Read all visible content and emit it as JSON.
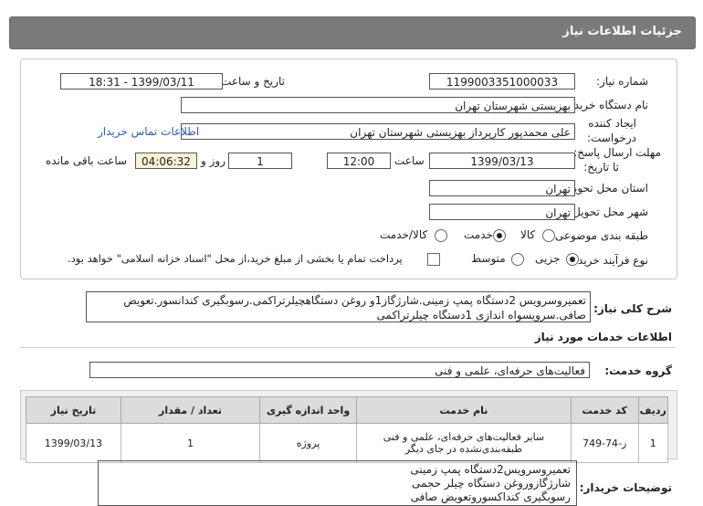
{
  "header": {
    "title": "جزئیات اطلاعات نیاز"
  },
  "fields": {
    "need_number_label": "شماره نیاز:",
    "need_number": "1199003351000033",
    "announce_label": "تاریخ و ساعت اعلان عمومی:",
    "announce_value": "1399/03/11 - 18:31",
    "buyer_org_label": "نام دستگاه خریدار:",
    "buyer_org": "بهزیستی شهرستان تهران",
    "requester_label_1": "ایجاد کننده",
    "requester_label_2": "درخواست:",
    "requester": "علی  محمدپور کارپرداز  بهزیستی شهرستان تهران",
    "contact_link": "اطلاعات تماس خریدار",
    "deadline_label_1": "مهلت ارسال پاسخ:",
    "deadline_label_2": "تا تاریخ:",
    "deadline_date": "1399/03/13",
    "time_label": "ساعت",
    "deadline_time": "12:00",
    "days_value": "1",
    "days_label": "روز و",
    "remaining_time": "04:06:32",
    "remaining_label": "ساعت باقی مانده",
    "province_label": "استان محل تحویل:",
    "province": "تهران",
    "city_label": "شهر محل تحویل:",
    "city": "تهران",
    "category_label": "طبقه بندی موضوعی:",
    "category_options": [
      "کالا",
      "خدمت",
      "کالا/خدمت"
    ],
    "category_selected": "خدمت",
    "process_label": "نوع فرآیند خرید :",
    "process_options": [
      "جزیی",
      "متوسط"
    ],
    "process_selected": "جزیی",
    "payment_note": "پرداخت تمام یا بخشی از مبلغ خرید،از محل \"اسناد خزانه اسلامی\" خواهد بود."
  },
  "description": {
    "label": "شرح کلی نیاز:",
    "text": "تعمیروسرویس 2دستگاه پمپ زمینی.شارژگاز1و روغن دستگاهچیلرتراکمی.رسوبگیری کندانسور.تعویض صافی.سرویسواه اندازی 1دستگاه چیلرتراکمی"
  },
  "services": {
    "section_title": "اطلاعات خدمات مورد نیاز",
    "group_label": "گروه خدمت:",
    "group_value": "فعالیت‌های حرفه‌ای، علمی و فنی",
    "columns": [
      "ردیف",
      "کد خدمت",
      "نام خدمت",
      "واحد اندازه گیری",
      "تعداد / مقدار",
      "تاریخ نیاز"
    ],
    "rows": [
      {
        "index": "1",
        "code": "ز-74-749",
        "name": "سایر فعالیت‌های حرفه‌ای، علمی و فنی طبقه‌بندی‌نشده در جای دیگر",
        "unit": "پروژه",
        "qty": "1",
        "date": "1399/03/13"
      }
    ]
  },
  "buyer_notes": {
    "label": "توضیحات خریدار:",
    "lines": [
      "تعمیروسرویس2دستگاه پمپ زمینی",
      "شارژگازوروغن دستگاه چیلر حجمی",
      "رسوبگیری کنداکسوروتعویض صافی"
    ]
  }
}
